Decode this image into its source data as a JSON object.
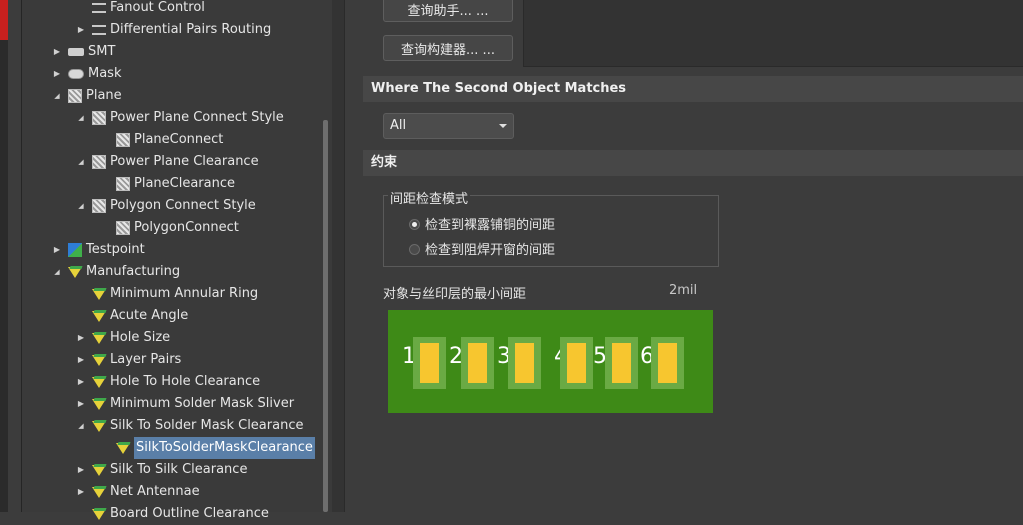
{
  "tree": {
    "items": [
      {
        "label": "Fanout Control",
        "indent": 2,
        "expander": "",
        "icon": "tool-icon"
      },
      {
        "label": "Differential Pairs Routing",
        "indent": 2,
        "expander": "collapsed",
        "icon": "diff-pair-icon"
      },
      {
        "label": "SMT",
        "indent": 1,
        "expander": "collapsed",
        "icon": "smt-icon"
      },
      {
        "label": "Mask",
        "indent": 1,
        "expander": "collapsed",
        "icon": "mask-icon"
      },
      {
        "label": "Plane",
        "indent": 1,
        "expander": "expanded",
        "icon": "plane-icon"
      },
      {
        "label": "Power Plane Connect Style",
        "indent": 2,
        "expander": "expanded",
        "icon": "plane-icon"
      },
      {
        "label": "PlaneConnect",
        "indent": 3,
        "expander": "",
        "icon": "plane-icon"
      },
      {
        "label": "Power Plane Clearance",
        "indent": 2,
        "expander": "expanded",
        "icon": "plane-icon"
      },
      {
        "label": "PlaneClearance",
        "indent": 3,
        "expander": "",
        "icon": "plane-icon"
      },
      {
        "label": "Polygon Connect Style",
        "indent": 2,
        "expander": "expanded",
        "icon": "plane-icon"
      },
      {
        "label": "PolygonConnect",
        "indent": 3,
        "expander": "",
        "icon": "plane-icon"
      },
      {
        "label": "Testpoint",
        "indent": 1,
        "expander": "collapsed",
        "icon": "testpoint-icon"
      },
      {
        "label": "Manufacturing",
        "indent": 1,
        "expander": "expanded",
        "icon": "rule-icon"
      },
      {
        "label": "Minimum Annular Ring",
        "indent": 2,
        "expander": "",
        "icon": "rule-icon"
      },
      {
        "label": "Acute Angle",
        "indent": 2,
        "expander": "",
        "icon": "rule-icon"
      },
      {
        "label": "Hole Size",
        "indent": 2,
        "expander": "collapsed",
        "icon": "rule-icon"
      },
      {
        "label": "Layer Pairs",
        "indent": 2,
        "expander": "collapsed",
        "icon": "rule-icon"
      },
      {
        "label": "Hole To Hole Clearance",
        "indent": 2,
        "expander": "collapsed",
        "icon": "rule-icon"
      },
      {
        "label": "Minimum Solder Mask Sliver",
        "indent": 2,
        "expander": "collapsed",
        "icon": "rule-icon"
      },
      {
        "label": "Silk To Solder Mask Clearance",
        "indent": 2,
        "expander": "expanded",
        "icon": "rule-icon"
      },
      {
        "label": "SilkToSolderMaskClearance",
        "indent": 3,
        "expander": "",
        "icon": "rule-icon",
        "selected": true
      },
      {
        "label": "Silk To Silk Clearance",
        "indent": 2,
        "expander": "collapsed",
        "icon": "rule-icon"
      },
      {
        "label": "Net Antennae",
        "indent": 2,
        "expander": "collapsed",
        "icon": "rule-icon"
      },
      {
        "label": "Board Outline Clearance",
        "indent": 2,
        "expander": "",
        "icon": "rule-icon"
      }
    ]
  },
  "query": {
    "helper_button": "查询助手... ...",
    "builder_button": "查询构建器... ..."
  },
  "second_match": {
    "header": "Where The Second Object Matches",
    "dropdown_value": "All"
  },
  "constraints": {
    "header": "约束",
    "group_title": "间距检查模式",
    "radio_bare_copper": "检查到裸露铺铜的间距",
    "radio_solder_mask": "检查到阻焊开窗的间距",
    "radio_selected": "bare_copper",
    "min_clearance_label": "对象与丝印层的最小间距",
    "min_clearance_value": "2mil",
    "pad_labels": [
      "1",
      "2",
      "3",
      "4",
      "5",
      "6"
    ]
  }
}
